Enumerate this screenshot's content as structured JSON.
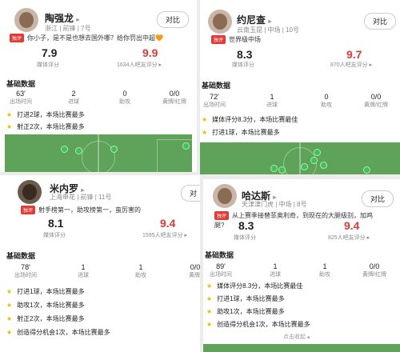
{
  "p1": {
    "name": "陶强龙",
    "arrow": "▸",
    "meta": "浙江 | 前锋 | 7号",
    "compare": "对比",
    "tag": "独评",
    "comment": "你小子，是不是也想去国外哪？给你罚出中超🧡",
    "media_score": "7.9",
    "media_label": "媒体评分",
    "fan_score": "9.9",
    "fan_label": "1634人吧友评分 ▸",
    "basic_title": "基础数据",
    "stats": [
      {
        "v": "63'",
        "l": "出场时间"
      },
      {
        "v": "2",
        "l": "进球"
      },
      {
        "v": "0",
        "l": "助攻"
      },
      {
        "v": "0/0",
        "l": "黄牌/红牌"
      }
    ],
    "highlights": [
      "打进2球，本场比赛最多",
      "射正2次，本场比赛最多"
    ]
  },
  "p2": {
    "name": "约尼查",
    "arrow": "▸",
    "meta": "云南玉昆 | 中场 | 10号",
    "compare": "对比",
    "tag": "独评",
    "comment": "世界级中场",
    "media_score": "8.3",
    "media_label": "媒体评分",
    "fan_score": "9.7",
    "fan_label": "870人吧友评分 ▸",
    "basic_title": "基础数据",
    "stats": [
      {
        "v": "72'",
        "l": "出场时间"
      },
      {
        "v": "1",
        "l": "进球"
      },
      {
        "v": "0",
        "l": "助攻"
      },
      {
        "v": "0/0",
        "l": "黄牌/红牌"
      }
    ],
    "highlights": [
      "媒体评分8.3分，本场比赛最佳",
      "打进1球，本场比赛最多"
    ]
  },
  "p3": {
    "name": "米内罗",
    "arrow": "▸",
    "meta": "上海申花 | 前锋 | 11号",
    "compare": "对",
    "tag": "独评",
    "comment": "射手榜第一，助攻榜第一，蛮厉害的",
    "media_score": "8.1",
    "media_label": "媒体评分",
    "fan_score": "9.4",
    "fan_label": "1595人吧友评分 ▸",
    "basic_title": "基础数据",
    "stats": [
      {
        "v": "78'",
        "l": "出场时间"
      },
      {
        "v": "1",
        "l": "进球"
      },
      {
        "v": "1",
        "l": "助攻"
      },
      {
        "v": "0/0",
        "l": "黄牌/"
      }
    ],
    "highlights": [
      "打进1球，本场比赛最多",
      "助攻1次，本场比赛最多",
      "射正2次，本场比赛最多",
      "创造得分机会1次，本场比赛最多"
    ]
  },
  "p4": {
    "name": "哈达斯",
    "arrow": "▸",
    "meta": "天津津门虎 | 中场 | 8号",
    "compare": "对比",
    "tag": "独评",
    "comment1": "从上赛季接替菲奥利奇，到现在的大腿级别，加鸡",
    "comment2": "腿?",
    "media_score": "8.3",
    "media_label": "媒体评分",
    "fan_score": "9.4",
    "fan_label": "825人吧友评分 ▸",
    "basic_title": "基础数据",
    "stats": [
      {
        "v": "89'",
        "l": "出场时间"
      },
      {
        "v": "1",
        "l": "进球"
      },
      {
        "v": "1",
        "l": "助攻"
      },
      {
        "v": "0/0",
        "l": "黄牌/红牌"
      }
    ],
    "highlights": [
      "媒体评分8.3分，本场比赛最佳",
      "打进1球，本场比赛最多",
      "助攻1次，本场比赛最多",
      "创造得分机会1次，本场比赛最多"
    ],
    "more": "点击收起 ▴"
  },
  "colors": {
    "accent_red": "#e53935",
    "star": "#f5b800",
    "pitch": "#5fa35a"
  }
}
